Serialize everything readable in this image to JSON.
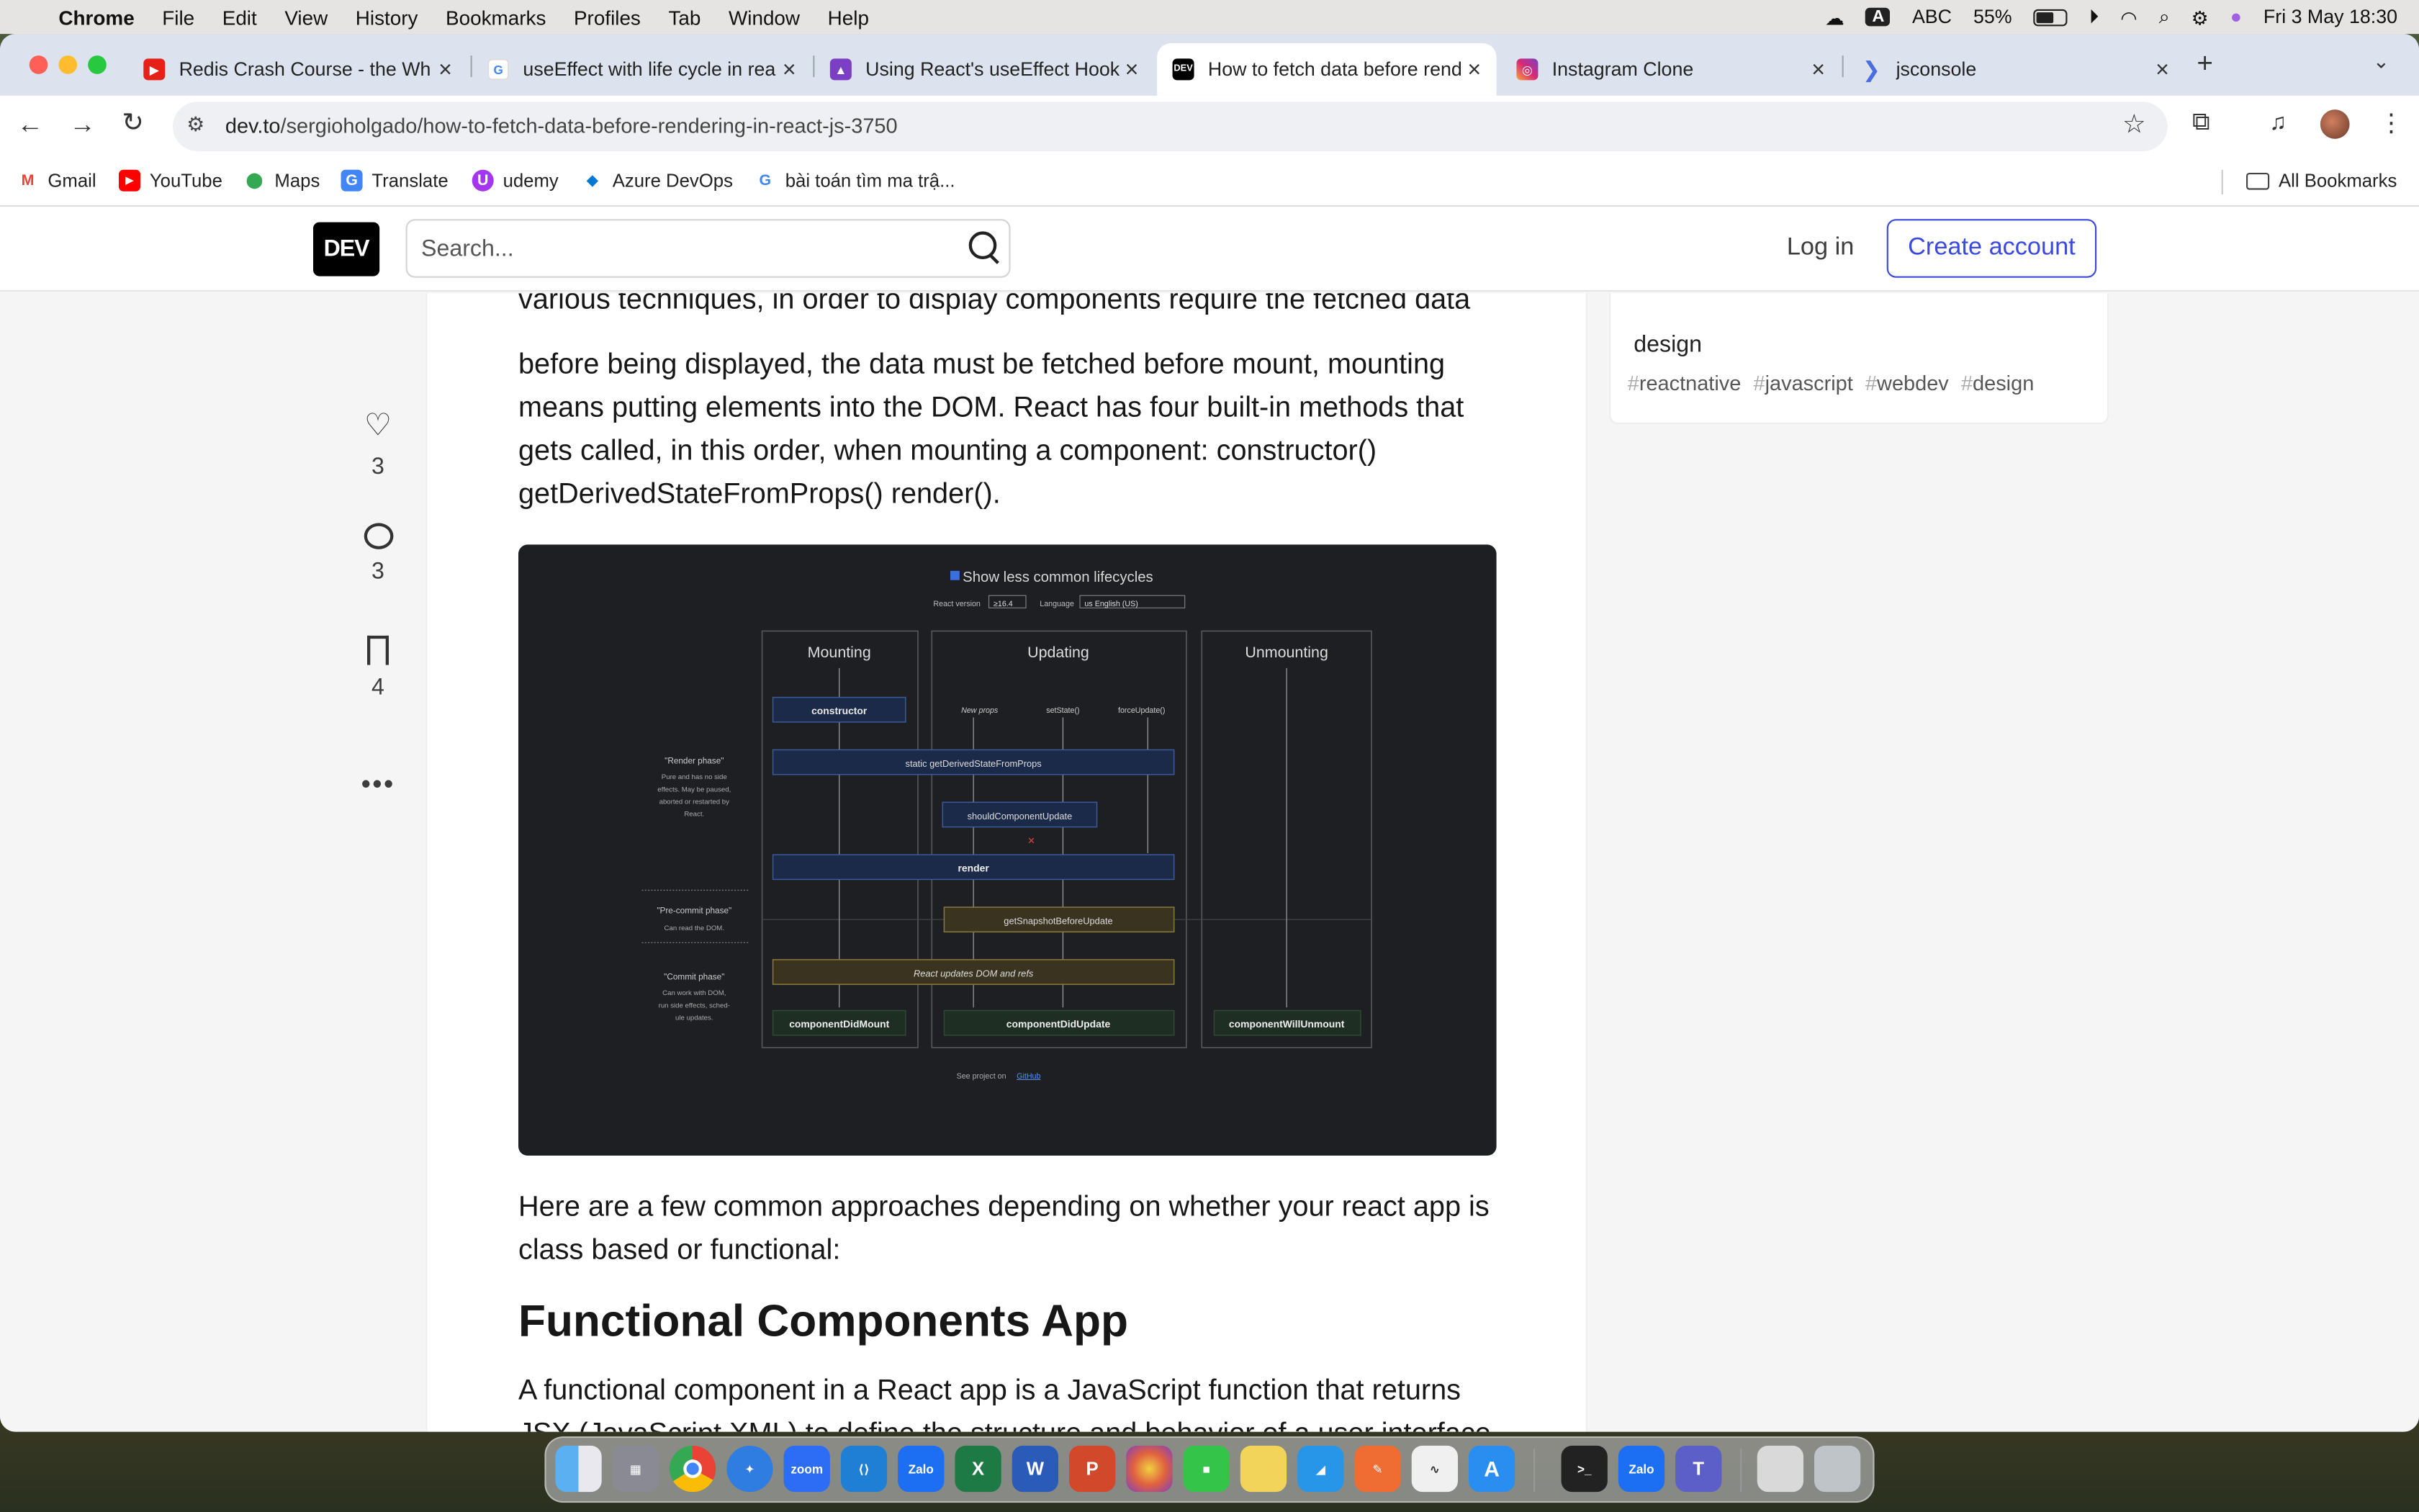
{
  "menubar": {
    "app": "Chrome",
    "items": [
      "File",
      "Edit",
      "View",
      "History",
      "Bookmarks",
      "Profiles",
      "Tab",
      "Window",
      "Help"
    ],
    "input_source": "ABC",
    "battery": "55%",
    "datetime": "Fri 3 May  18:30"
  },
  "tabs": [
    {
      "title": "Redis Crash Course - the Wh",
      "color": "#e62117",
      "glyph": "▶"
    },
    {
      "title": "useEffect with life cycle in rea",
      "color": "#4285f4",
      "glyph": "G"
    },
    {
      "title": "Using React's useEffect Hook",
      "color": "#7b3fc4",
      "glyph": "▲"
    },
    {
      "title": "How to fetch data before rend",
      "color": "#000000",
      "glyph": "DEV"
    },
    {
      "title": "Instagram Clone",
      "color": "#d62976",
      "glyph": "◎"
    },
    {
      "title": "jsconsole",
      "color": "#4a6ee0",
      "glyph": ">"
    }
  ],
  "address": {
    "domain": "dev.to",
    "path": "/sergioholgado/how-to-fetch-data-before-rendering-in-react-js-3750"
  },
  "bookmarks": [
    {
      "label": "Gmail",
      "glyph": "M",
      "color": "#ea4335"
    },
    {
      "label": "YouTube",
      "glyph": "▶",
      "color": "#ff0000"
    },
    {
      "label": "Maps",
      "glyph": "⬤",
      "color": "#34a853"
    },
    {
      "label": "Translate",
      "glyph": "G",
      "color": "#4285f4"
    },
    {
      "label": "udemy",
      "glyph": "U",
      "color": "#a435f0"
    },
    {
      "label": "Azure DevOps",
      "glyph": "◆",
      "color": "#0078d4"
    },
    {
      "label": "bài toán tìm ma trậ...",
      "glyph": "G",
      "color": "#4285f4"
    }
  ],
  "all_bookmarks": "All Bookmarks",
  "dev": {
    "logo": "DEV",
    "search_placeholder": "Search...",
    "login": "Log in",
    "create_account": "Create account"
  },
  "reactions": {
    "likes": "3",
    "comments": "3",
    "saves": "4"
  },
  "article": {
    "para1_partial": "various techniques, in order to display components require the fetched data",
    "para1": "before being displayed, the data must be fetched before mount, mounting means putting elements into the DOM. React has four built-in methods that gets called, in this order, when mounting a component: constructor() getDerivedStateFromProps() render().",
    "para2": "Here are a few common approaches depending on whether your react app is class based or functional:",
    "heading": "Functional Components App",
    "para3": "A functional component in a React app is a JavaScript function that returns JSX (JavaScript XML) to define the structure and behavior of a user interface"
  },
  "diagram": {
    "checkbox": "Show less common lifecycles",
    "react_version_label": "React version",
    "react_version": "≥16.4",
    "language_label": "Language",
    "language": "us English (US)",
    "columns": [
      "Mounting",
      "Updating",
      "Unmounting"
    ],
    "render_phase": "\"Render phase\"",
    "render_phase_desc": [
      "Pure and has no side",
      "effects. May be paused,",
      "aborted or restarted by",
      "React."
    ],
    "precommit_phase": "\"Pre-commit phase\"",
    "precommit_desc": "Can read the DOM.",
    "commit_phase": "\"Commit phase\"",
    "commit_desc": [
      "Can work with DOM,",
      "run side effects, sched-",
      "ule updates."
    ],
    "constructor": "constructor",
    "new_props": "New props",
    "set_state": "setState()",
    "force_update": "forceUpdate()",
    "gdsfp": "static getDerivedStateFromProps",
    "scu": "shouldComponentUpdate",
    "render": "render",
    "gsbu": "getSnapshotBeforeUpdate",
    "react_updates": "React updates DOM and refs",
    "cdm": "componentDidMount",
    "cdu": "componentDidUpdate",
    "cwu": "componentWillUnmount",
    "footer": "See project on",
    "github": "GitHub"
  },
  "sidebar": {
    "title": "design",
    "tags": [
      "reactnative",
      "javascript",
      "webdev",
      "design"
    ]
  },
  "dock": [
    {
      "name": "finder",
      "color": "#3a8de8"
    },
    {
      "name": "launchpad",
      "color": "#8a8a95"
    },
    {
      "name": "chrome",
      "color": "#e8b030"
    },
    {
      "name": "safari",
      "color": "#2f7de0"
    },
    {
      "name": "zoom",
      "color": "#2d6cf5",
      "label": "zoom"
    },
    {
      "name": "vscode",
      "color": "#1f7fd4"
    },
    {
      "name": "zalo",
      "color": "#1c6ef2",
      "label": "Zalo"
    },
    {
      "name": "excel",
      "color": "#1d7a44"
    },
    {
      "name": "word",
      "color": "#2b5bb8"
    },
    {
      "name": "powerpoint",
      "color": "#d2482a"
    },
    {
      "name": "photos",
      "color": "#e8a040"
    },
    {
      "name": "facetime",
      "color": "#35c44a"
    },
    {
      "name": "notes",
      "color": "#f2d45a"
    },
    {
      "name": "docker",
      "color": "#2796e8"
    },
    {
      "name": "postman",
      "color": "#ef6c32"
    },
    {
      "name": "freeform",
      "color": "#f0f0f0"
    },
    {
      "name": "appstore",
      "color": "#2a8df0"
    },
    {
      "name": "terminal",
      "color": "#222"
    },
    {
      "name": "zalo2",
      "color": "#1c6ef2",
      "label": "Zalo"
    },
    {
      "name": "teams",
      "color": "#5b5fc7"
    },
    {
      "name": "preview",
      "color": "#d9d9d9"
    },
    {
      "name": "trash",
      "color": "#bfc4c9"
    }
  ]
}
